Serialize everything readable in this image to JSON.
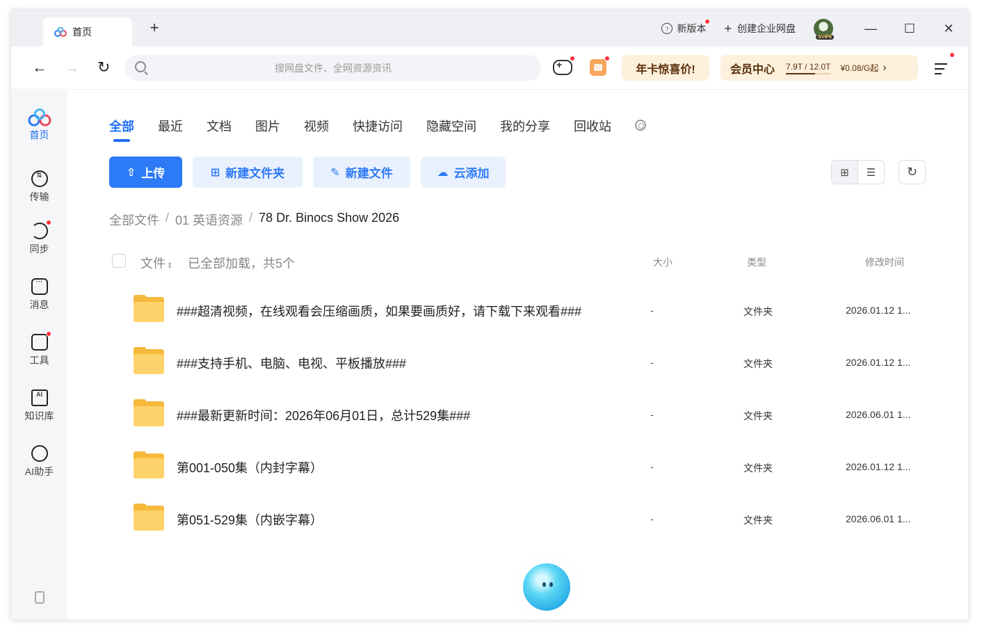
{
  "titlebar": {
    "tab_label": "首页",
    "new_version": "新版本",
    "create_enterprise": "创建企业网盘",
    "avatar_badge": "SVIP6"
  },
  "toolbar": {
    "search_placeholder": "搜网盘文件、全网资源资讯",
    "promo_label": "年卡惊喜价!",
    "vip_label": "会员中心",
    "storage_text": "7.9T / 12.0T",
    "storage_used_fraction": 0.658,
    "price_text": "¥0.08/G起",
    "price_chevron": "›"
  },
  "sidebar": {
    "items": [
      {
        "label": "首页",
        "icon": "home-logo-icon"
      },
      {
        "label": "传输",
        "icon": "transfer-icon"
      },
      {
        "label": "同步",
        "icon": "sync-icon"
      },
      {
        "label": "消息",
        "icon": "message-icon"
      },
      {
        "label": "工具",
        "icon": "toolbox-icon"
      },
      {
        "label": "知识库",
        "icon": "knowledge-icon"
      },
      {
        "label": "AI助手",
        "icon": "ai-assistant-icon"
      }
    ]
  },
  "categories": [
    "全部",
    "最近",
    "文档",
    "图片",
    "视频",
    "快捷访问",
    "隐藏空间",
    "我的分享",
    "回收站"
  ],
  "actions": {
    "upload": "上传",
    "new_folder": "新建文件夹",
    "new_file": "新建文件",
    "cloud_add": "云添加"
  },
  "breadcrumb": {
    "root": "全部文件",
    "level1": "01 英语资源",
    "current": "78 Dr. Binocs Show 2026",
    "separator": "/"
  },
  "table": {
    "header_file": "文件",
    "header_count": "已全部加载，共5个",
    "header_size": "大小",
    "header_type": "类型",
    "header_time": "修改时间",
    "rows": [
      {
        "name": "###超清视频，在线观看会压缩画质，如果要画质好，请下载下来观看###",
        "size": "-",
        "type": "文件夹",
        "time": "2026.01.12 1..."
      },
      {
        "name": "###支持手机、电脑、电视、平板播放###",
        "size": "-",
        "type": "文件夹",
        "time": "2026.01.12 1..."
      },
      {
        "name": "###最新更新时间：2026年06月01日，总计529集###",
        "size": "-",
        "type": "文件夹",
        "time": "2026.06.01 1..."
      },
      {
        "name": "第001-050集（内封字幕）",
        "size": "-",
        "type": "文件夹",
        "time": "2026.01.12 1..."
      },
      {
        "name": "第051-529集（内嵌字幕）",
        "size": "-",
        "type": "文件夹",
        "time": "2026.06.01 1..."
      }
    ]
  },
  "colors": {
    "accent": "#2d7af6",
    "promo_bg": "#fdf0dc",
    "folder": "#ffd36b",
    "notification": "#ff2e3a"
  }
}
